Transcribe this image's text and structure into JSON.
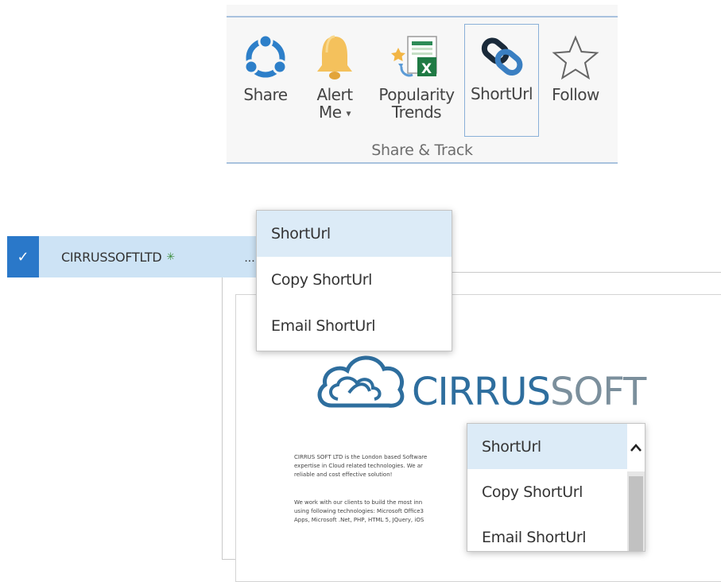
{
  "ribbon": {
    "buttons": [
      {
        "label": "Share",
        "icon": "share-icon"
      },
      {
        "label_line1": "Alert",
        "label_line2": "Me",
        "icon": "bell-icon"
      },
      {
        "label_line1": "Popularity",
        "label_line2": "Trends",
        "icon": "excel-trends-icon"
      },
      {
        "label": "ShortUrl",
        "icon": "chain-link-icon"
      },
      {
        "label": "Follow",
        "icon": "star-icon"
      }
    ],
    "group_label": "Share & Track"
  },
  "list_row": {
    "title": "CIRRUSSOFTLTD",
    "new_badge": "✳",
    "checked": true,
    "ellipsis": "..."
  },
  "menu_top": {
    "items": [
      "ShortUrl",
      "Copy ShortUrl",
      "Email ShortUrl"
    ]
  },
  "menu_bottom": {
    "items": [
      "ShortUrl",
      "Copy ShortUrl",
      "Email ShortUrl"
    ]
  },
  "preview": {
    "brand_part1": "CIRRUS",
    "brand_part2": "SOFT",
    "paragraph1": [
      "CIRRUS SOFT LTD is the London based Software",
      "expertise in Cloud related technologies. We ar",
      "reliable and cost effective solution!"
    ],
    "paragraph2": [
      "We work with our clients to build the most inn",
      "using following technologies: Microsoft Office3",
      "Apps, Microsoft .Net, PHP, HTML 5, JQuery, iOS"
    ]
  },
  "colors": {
    "ribbon_line": "#a9c2de",
    "selection_blue": "#2a78c9",
    "row_highlight": "#cde3f5",
    "menu_highlight": "#dcebf7",
    "brand_blue": "#2e6e9e",
    "brand_gray": "#7b8f9c"
  }
}
